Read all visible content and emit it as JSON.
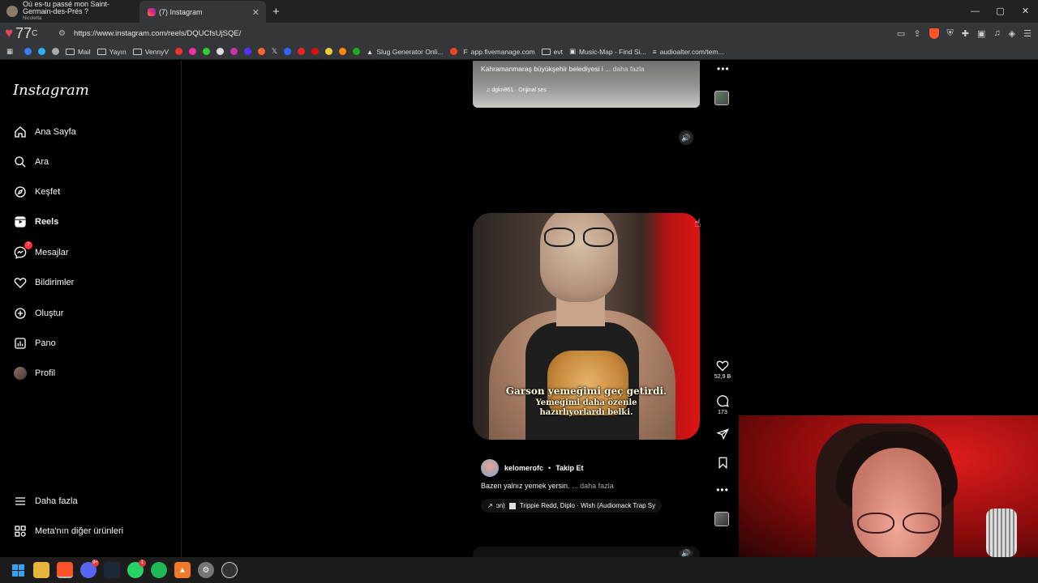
{
  "browser": {
    "tabs": [
      {
        "title": "Où es-tu passé mon Saint-Germain-des-Prés ?",
        "subtitle": "Nicoletta"
      },
      {
        "title": "(7) Instagram"
      }
    ],
    "new_tab": "+",
    "window_controls": [
      "—",
      "▢",
      "✕"
    ],
    "weather": {
      "temp": "77",
      "unit": "C"
    },
    "url": "https://www.instagram.com/reels/DQUCfsUjSQE/",
    "bookmarks": [
      "Mail",
      "Yayın",
      "VennyV",
      "Slug Generator Onli...",
      "app.fivemanage.com",
      "evt",
      "Music-Map - Find Si...",
      "audioalter.com/tem..."
    ],
    "shield_badge": "2"
  },
  "instagram": {
    "logo": "Instagram",
    "nav": [
      {
        "label": "Ana Sayfa",
        "icon": "home-icon"
      },
      {
        "label": "Ara",
        "icon": "search-icon"
      },
      {
        "label": "Keşfet",
        "icon": "compass-icon"
      },
      {
        "label": "Reels",
        "icon": "reels-icon"
      },
      {
        "label": "Mesajlar",
        "icon": "messenger-icon",
        "badge": "7"
      },
      {
        "label": "Bildirimler",
        "icon": "heart-icon"
      },
      {
        "label": "Oluştur",
        "icon": "plus-square-icon"
      },
      {
        "label": "Pano",
        "icon": "dashboard-icon"
      },
      {
        "label": "Profil",
        "icon": "avatar"
      }
    ],
    "more": "Daha fazla",
    "meta_products": "Meta'nın diğer ürünleri"
  },
  "previous_reel": {
    "caption": "Kahramanmaraş büyükşehir belediyesi i ...",
    "more": "daha fazla",
    "audio": "dgkn861 · Orijinal ses"
  },
  "current_reel": {
    "subtitle_line1": "Garson yemeğimi geç getirdi.",
    "subtitle_line2": "Yemeğimi daha özenle",
    "subtitle_line3": "hazırlıyorlardı belki.",
    "username": "kelomerofc",
    "separator": "•",
    "follow": "Takip Et",
    "caption": "Bazen yalnız yemek yersin.",
    "caption_more": "... daha fazla",
    "audio": "Trippie Redd, Diplo · Wish (Audiomack Trap Sy",
    "likes": "52,9 B",
    "comments": "173"
  },
  "taskbar": {
    "discord_badge": "9+",
    "whatsapp_badge": "1"
  },
  "colors": {
    "notification_red": "#ff3040",
    "background": "#000000"
  }
}
